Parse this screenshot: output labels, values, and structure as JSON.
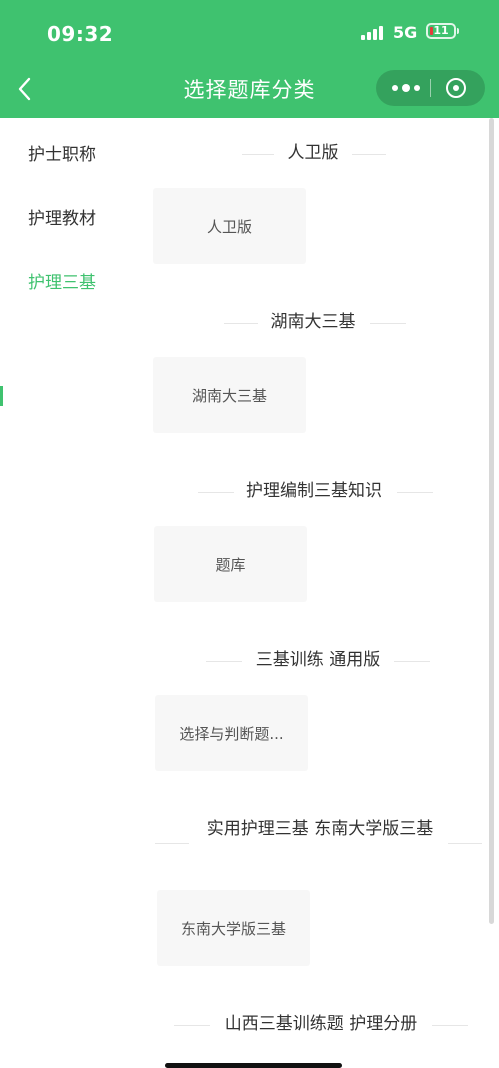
{
  "status_bar": {
    "time": "09:32",
    "network": "5G",
    "battery": "11"
  },
  "nav": {
    "title": "选择题库分类"
  },
  "sidebar": {
    "items": [
      {
        "label": "护士职称"
      },
      {
        "label": "护理教材"
      },
      {
        "label": "护理三基"
      }
    ]
  },
  "sections": [
    {
      "title": "人卫版",
      "card": "人卫版"
    },
    {
      "title": "湖南大三基",
      "card": "湖南大三基"
    },
    {
      "title": "护理编制三基知识",
      "card": "题库"
    },
    {
      "title": "三基训练 通用版",
      "card": "选择与判断题..."
    },
    {
      "title": "实用护理三基 东南大学版三基",
      "card": "东南大学版三基"
    },
    {
      "title": "山西三基训练题 护理分册"
    }
  ],
  "colors": {
    "accent": "#3fc26f"
  }
}
